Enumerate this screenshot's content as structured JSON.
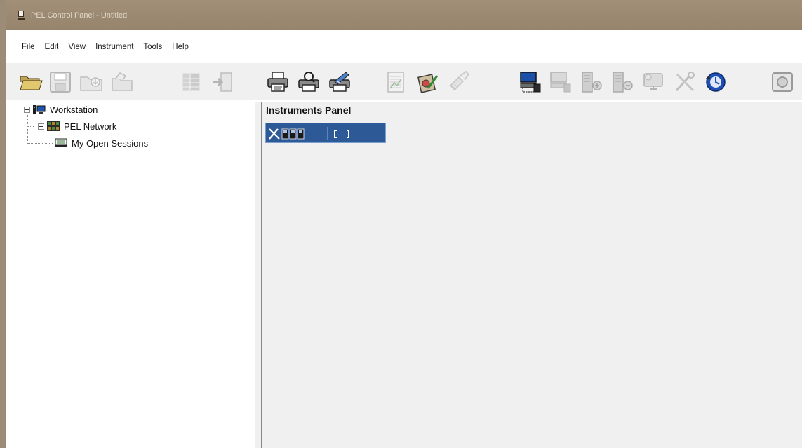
{
  "window": {
    "title": "PEL Control Panel - Untitled"
  },
  "menu": [
    "File",
    "Edit",
    "View",
    "Instrument",
    "Tools",
    "Help"
  ],
  "toolbar_icons": [
    "open-folder-icon",
    "save-icon",
    "download-folder-icon",
    "folder-icon",
    "grid-icon",
    "import-icon",
    "printer-icon",
    "print-preview-icon",
    "print-setup-icon",
    "report-icon",
    "edit-icon",
    "brush-icon",
    "connect-icon",
    "disconnect-icon",
    "add-instrument-icon",
    "remove-instrument-icon",
    "monitor-icon",
    "tools-icon",
    "sync-icon",
    "more-icon"
  ],
  "tree": {
    "root": "Workstation",
    "children": [
      "PEL Network",
      "My Open Sessions"
    ]
  },
  "instruments_panel": {
    "title": "Instruments Panel",
    "toolbar_icons": [
      "wrench-icon",
      "instrument-a-icon",
      "instrument-b-icon",
      "instrument-c-icon",
      "fullscreen-icon"
    ]
  }
}
